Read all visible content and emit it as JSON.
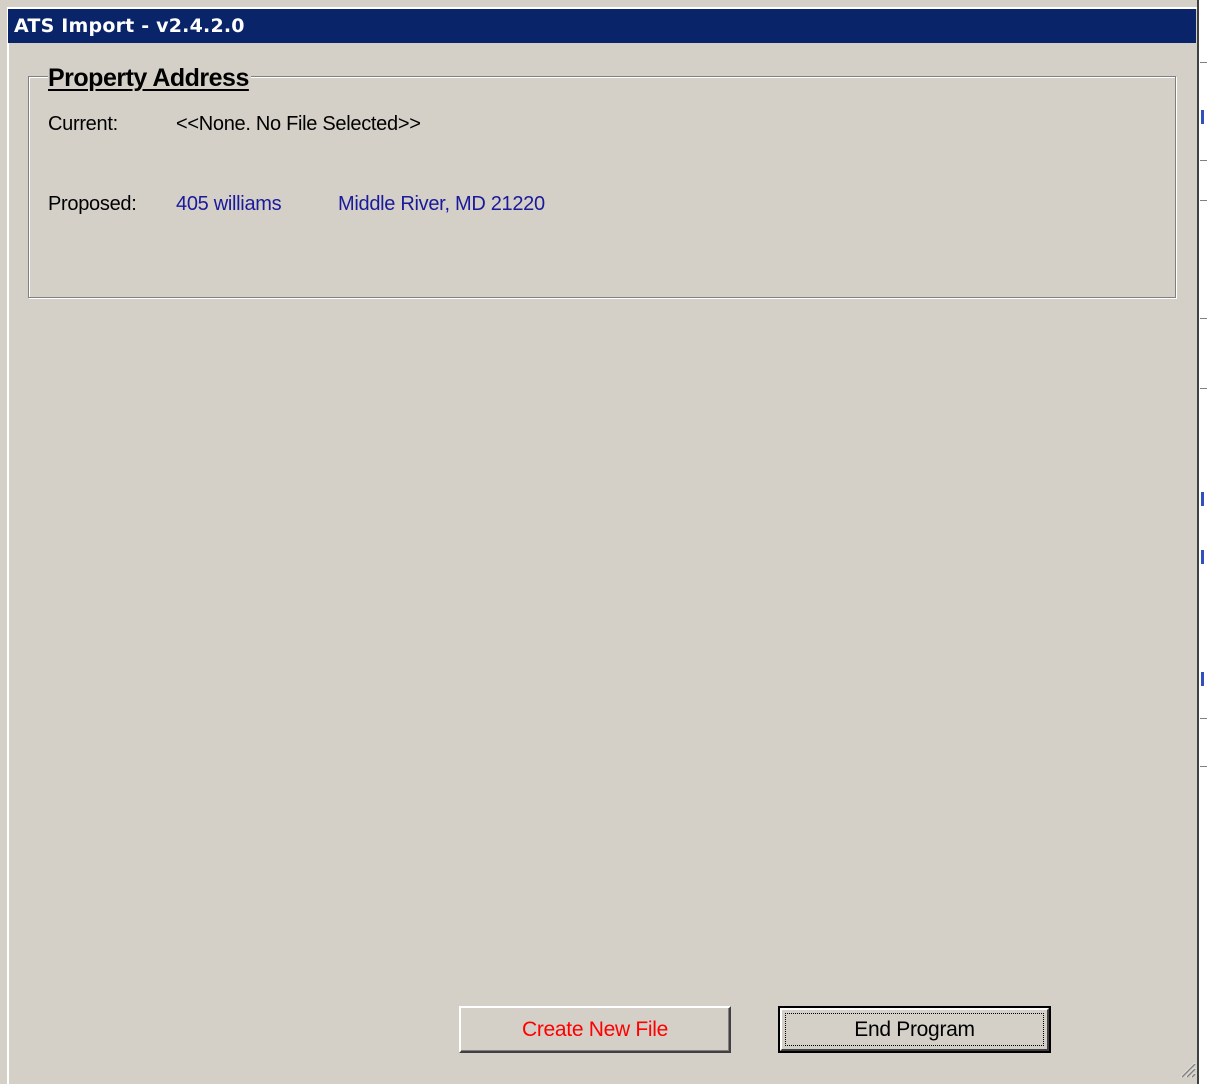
{
  "window": {
    "title": "ATS Import - v2.4.2.0"
  },
  "property_address": {
    "legend": "Property Address",
    "current_label": "Current:",
    "current_value": "<<None.  No File Selected>>",
    "proposed_label": "Proposed:",
    "proposed_street": "405  williams",
    "proposed_city": "Middle River, MD  21220"
  },
  "buttons": {
    "create_new_file": "Create New File",
    "end_program": "End Program"
  },
  "colors": {
    "titlebar": "#0a246a",
    "face": "#d4d0c8",
    "proposed_text": "#1a1a9a",
    "create_button_text": "#ff0000"
  },
  "icons": {
    "resize_grip": "size-grip-icon"
  }
}
